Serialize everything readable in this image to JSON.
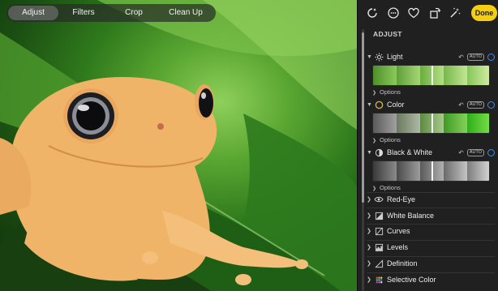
{
  "tabs": [
    {
      "label": "Adjust",
      "active": true
    },
    {
      "label": "Filters",
      "active": false
    },
    {
      "label": "Crop",
      "active": false
    },
    {
      "label": "Clean Up",
      "active": false
    }
  ],
  "toolbar": {
    "icons": [
      "enhance-icon",
      "more-icon",
      "favorite-heart-icon",
      "rotate-icon",
      "magic-wand-icon"
    ],
    "done_label": "Done"
  },
  "panel": {
    "section_title": "ADJUST",
    "adjustments": [
      {
        "label": "Light",
        "expanded": true,
        "icon": "sun-icon",
        "auto": "AUTO",
        "options": "Options"
      },
      {
        "label": "Color",
        "expanded": true,
        "icon": "color-circle-icon",
        "auto": "AUTO",
        "options": "Options"
      },
      {
        "label": "Black & White",
        "expanded": true,
        "icon": "half-circle-icon",
        "auto": "AUTO",
        "options": "Options"
      },
      {
        "label": "Red-Eye",
        "expanded": false,
        "icon": "eye-icon"
      },
      {
        "label": "White Balance",
        "expanded": false,
        "icon": "white-balance-icon"
      },
      {
        "label": "Curves",
        "expanded": false,
        "icon": "curves-icon"
      },
      {
        "label": "Levels",
        "expanded": false,
        "icon": "levels-icon"
      },
      {
        "label": "Definition",
        "expanded": false,
        "icon": "definition-icon"
      },
      {
        "label": "Selective Color",
        "expanded": false,
        "icon": "selective-color-icon"
      }
    ]
  },
  "colors": {
    "accent_done": "#f5cf0f",
    "toggle_blue": "#3b8af5",
    "panel_bg": "#202020"
  }
}
